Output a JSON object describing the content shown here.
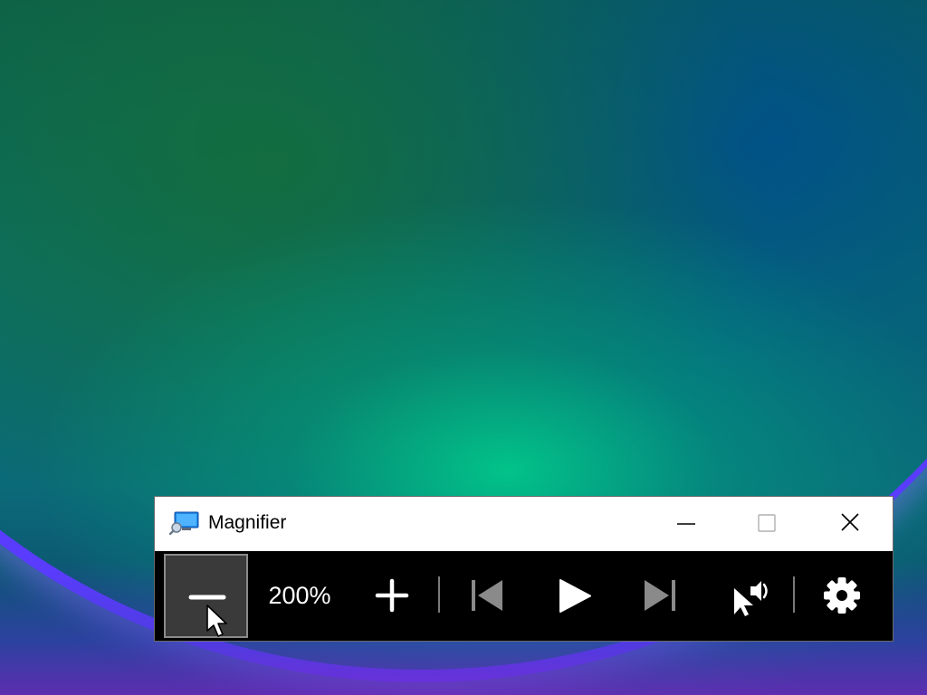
{
  "window": {
    "title": "Magnifier",
    "app_icon": "magnifier-app-icon"
  },
  "caption_buttons": {
    "minimize": "minimize-icon",
    "maximize": "maximize-icon",
    "close": "close-icon"
  },
  "toolbar": {
    "zoom_out_icon": "minus-icon",
    "zoom_level": "200%",
    "zoom_in_icon": "plus-icon",
    "previous_icon": "skip-previous-icon",
    "play_icon": "play-icon",
    "next_icon": "skip-next-icon",
    "read_from_here_icon": "read-from-pointer-icon",
    "settings_icon": "gear-icon"
  },
  "colors": {
    "titlebar_bg": "#ffffff",
    "toolbar_bg": "#000000",
    "pressed_button_bg": "#3a3a3a",
    "pressed_button_border": "#8a8a8a",
    "disabled_icon": "#8a8a8a",
    "icon": "#ffffff"
  }
}
